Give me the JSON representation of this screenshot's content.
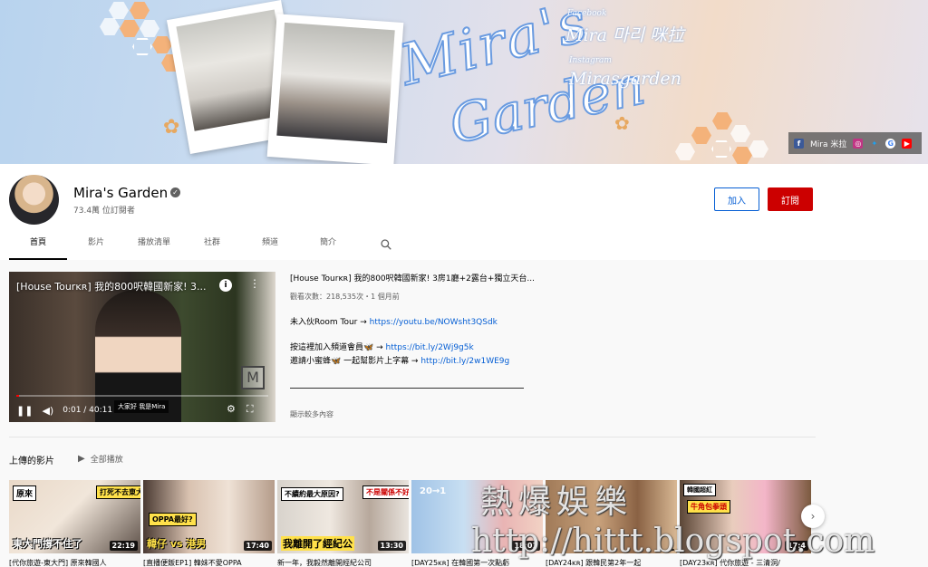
{
  "banner": {
    "title_line1": "Mira's",
    "title_line2": "Garden",
    "facebook_label": "Facebook",
    "facebook_name": "Mira 마리 咪拉",
    "instagram_label": "Instagram",
    "instagram_name": "Mirasgarden",
    "links_bar_label": "Mira 米拉"
  },
  "channel": {
    "name": "Mira's Garden",
    "subscribers": "73.4萬 位訂閱者",
    "join_label": "加入",
    "subscribe_label": "訂閱"
  },
  "tabs": [
    {
      "label": "首頁"
    },
    {
      "label": "影片"
    },
    {
      "label": "播放清單"
    },
    {
      "label": "社群"
    },
    {
      "label": "頻道"
    },
    {
      "label": "簡介"
    }
  ],
  "featured": {
    "player_title": "[House Tourᴋʀ] 我的800呎韓國新家! 3...",
    "subtitle": "大家好 我是Mira",
    "time": "0:01 / 40:11",
    "progress": 0.01,
    "title": "[House Tourᴋʀ] 我的800呎韓國新家! 3房1廳+2露台+獨立天台...",
    "meta": "觀看次數：218,535次・1 個月前",
    "line1_text": "未入伙Room Tour → ",
    "line1_link": "https://youtu.be/NOWsht3QSdk",
    "line2_text": "按這裡加入頻道會員🦋 → ",
    "line2_link": "https://bit.ly/2Wj9g5k",
    "line3_text": "邀請小蜜蜂🦋 一起幫影片上字幕 → ",
    "line3_link": "http://bit.ly/2w1WE9g",
    "read_more": "顯示較多內容"
  },
  "uploads": {
    "title": "上傳的影片",
    "play_all": "全部播放",
    "videos": [
      {
        "title": "[代你旅遊-東大門] 原來韓國人",
        "duration": "22:19",
        "caption": "東大門撐不住了",
        "tag1": "原來",
        "tag2": "打死不去東大門!!"
      },
      {
        "title": "[直播便飯EP1] 韓妹不愛OPPA",
        "duration": "17:40",
        "caption": "韓仔 vs 港男",
        "tag1": "OPPA最好?",
        "tag2": ""
      },
      {
        "title": "新一年，我毅然離開經紀公司",
        "duration": "13:30",
        "caption": "我離開了經紀公",
        "tag1": "不續約最大原因?",
        "tag2": "不是關係不好?"
      },
      {
        "title": "[DAY25ᴋʀ] 在韓國第一次點虧",
        "duration": "18:01",
        "caption": "",
        "tag1": "20→1",
        "tag2": ""
      },
      {
        "title": "[DAY24ᴋʀ] 跟韓民第2年一起",
        "duration": "",
        "caption": "",
        "tag1": "",
        "tag2": ""
      },
      {
        "title": "[DAY23ᴋʀ] 代你旅遊 - 三清洞/",
        "duration": "17:4",
        "caption": "",
        "tag1": "韓國超紅",
        "tag2": "牛角包拳頭"
      }
    ]
  },
  "watermark": {
    "line1": "熱爆娛樂",
    "line2": "http://hittt.blogspot.com"
  },
  "colors": {
    "subscribe_red": "#cc0000",
    "link_blue": "#065fd4"
  }
}
